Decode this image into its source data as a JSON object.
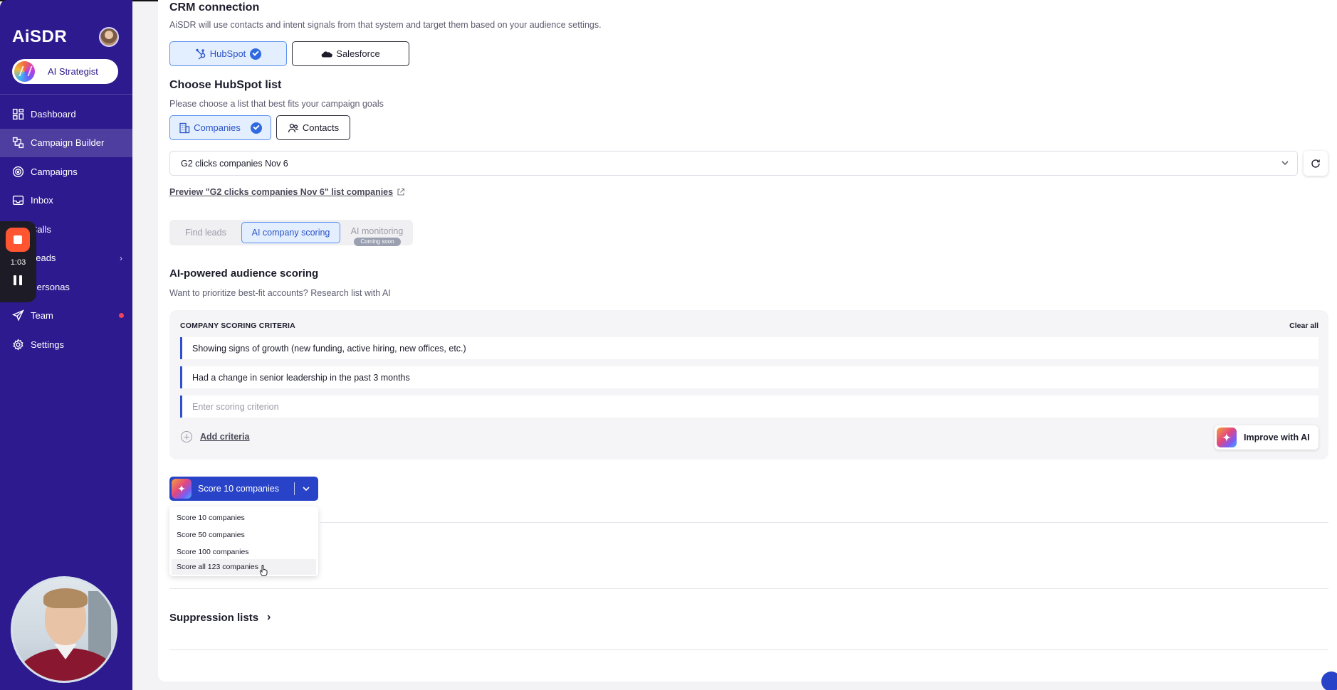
{
  "sidebar": {
    "brand": "AiSDR",
    "strategist_label": "AI Strategist",
    "items": [
      {
        "label": "Dashboard",
        "icon": "dashboard-icon"
      },
      {
        "label": "Campaign Builder",
        "icon": "campaign-builder-icon",
        "active": true
      },
      {
        "label": "Campaigns",
        "icon": "target-icon"
      },
      {
        "label": "Inbox",
        "icon": "inbox-icon"
      },
      {
        "label": "Calls",
        "icon": "phone-icon"
      },
      {
        "label": "Leads",
        "icon": "leads-icon",
        "has_chevron": true
      },
      {
        "label": "Personas",
        "icon": "personas-icon"
      },
      {
        "label": "Team",
        "icon": "send-icon",
        "has_dot": true
      },
      {
        "label": "Settings",
        "icon": "gear-icon"
      }
    ]
  },
  "recorder": {
    "time": "1:03"
  },
  "crm": {
    "title": "CRM connection",
    "description": "AiSDR will use contacts and intent signals from that system and target them based on your audience settings.",
    "hubspot_label": "HubSpot",
    "salesforce_label": "Salesforce"
  },
  "list": {
    "title": "Choose HubSpot list",
    "description": "Please choose a list that best fits your campaign goals",
    "companies_label": "Companies",
    "contacts_label": "Contacts",
    "selected_list": "G2 clicks companies Nov 6",
    "preview_link": "Preview \"G2 clicks companies Nov 6\" list companies"
  },
  "tabs": {
    "find_leads": "Find leads",
    "ai_scoring": "AI company scoring",
    "ai_monitoring": "AI monitoring",
    "coming_soon": "Coming soon"
  },
  "scoring": {
    "title": "AI-powered audience scoring",
    "description": "Want to prioritize best-fit accounts? Research list with AI",
    "criteria_header": "COMPANY SCORING CRITERIA",
    "clear_all": "Clear all",
    "criteria": [
      "Showing signs of growth (new funding, active hiring, new offices, etc.)",
      "Had a change in senior leadership in the past 3 months"
    ],
    "placeholder": "Enter scoring criterion",
    "add_criteria": "Add criteria",
    "improve": "Improve with AI"
  },
  "score_button": {
    "label": "Score 10 companies",
    "options": [
      "Score 10 companies",
      "Score 50 companies",
      "Score 100 companies",
      "Score all 123 companies"
    ],
    "hovered_index": 3
  },
  "suppression": {
    "title": "Suppression lists"
  },
  "colors": {
    "sidebar": "#2c1a8e",
    "primary": "#2843c8",
    "selected_bg": "#e3eeff",
    "notification": "#f0435a"
  }
}
